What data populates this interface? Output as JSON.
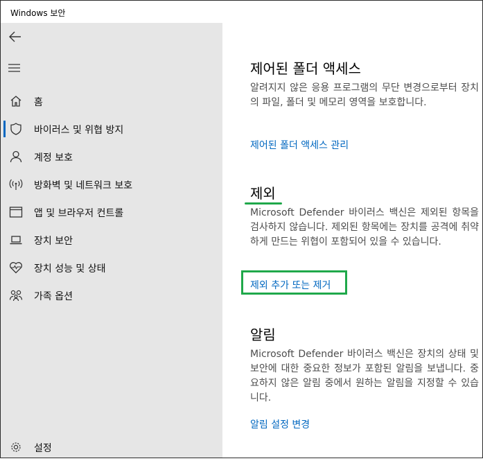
{
  "window": {
    "title": "Windows 보안"
  },
  "sidebar": {
    "items": [
      {
        "label": "홈",
        "icon": "home-icon"
      },
      {
        "label": "바이러스 및 위협 방지",
        "icon": "shield-icon",
        "selected": true
      },
      {
        "label": "계정 보호",
        "icon": "person-icon"
      },
      {
        "label": "방화벽 및 네트워크 보호",
        "icon": "wifi-antenna-icon"
      },
      {
        "label": "앱 및 브라우저 컨트롤",
        "icon": "app-window-icon"
      },
      {
        "label": "장치 보안",
        "icon": "laptop-icon"
      },
      {
        "label": "장치 성능 및 상태",
        "icon": "heart-pulse-icon"
      },
      {
        "label": "가족 옵션",
        "icon": "family-icon"
      }
    ],
    "settings": {
      "label": "설정",
      "icon": "gear-icon"
    }
  },
  "main": {
    "controlled_folder": {
      "heading": "제어된 폴더 액세스",
      "description": "알려지지 않은 응용 프로그램의 무단 변경으로부터 장치의 파일, 폴더 및 메모리 영역을 보호합니다.",
      "link": "제어된 폴더 액세스 관리"
    },
    "exclusions": {
      "heading": "제외",
      "description": "Microsoft Defender 바이러스 백신은 제외된 항목을 검사하지 않습니다. 제외된 항목에는 장치를 공격에 취약하게 만드는 위협이 포함되어 있을 수 있습니다.",
      "link": "제외 추가 또는 제거"
    },
    "notifications": {
      "heading": "알림",
      "description": "Microsoft Defender 바이러스 백신은 장치의 상태 및 보안에 대한 중요한 정보가 포함된 알림을 보냅니다. 중요하지 않은 알림 중에서 원하는 알림을 지정할 수 있습니다.",
      "link": "알림 설정 변경"
    }
  },
  "colors": {
    "accent": "#0067c0",
    "highlight": "#1fa84a",
    "sidebar_bg": "#e6e6e6"
  }
}
